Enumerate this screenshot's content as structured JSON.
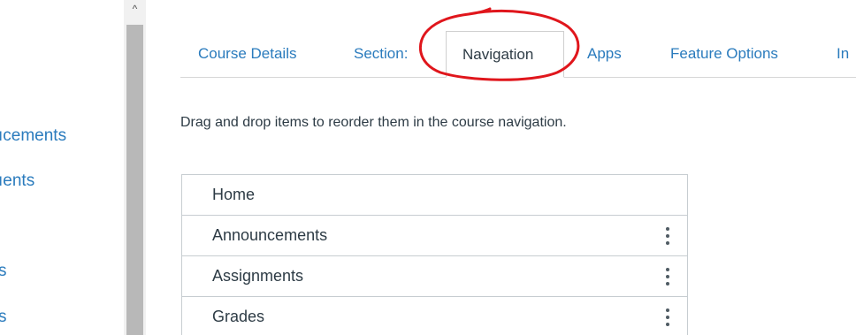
{
  "left_nav": {
    "items": [
      {
        "label": "ıcements"
      },
      {
        "label": "ıents"
      },
      {
        "label": "s"
      },
      {
        "label": "s"
      }
    ]
  },
  "scrollbar": {
    "up_arrow": "^"
  },
  "tabs": [
    {
      "label": "Course Details"
    },
    {
      "label": "Section:"
    },
    {
      "label": "Navigation",
      "active": true
    },
    {
      "label": "Apps"
    },
    {
      "label": "Feature Options"
    },
    {
      "label": "In"
    }
  ],
  "instructions": "Drag and drop items to reorder them in the course navigation.",
  "nav_items": [
    {
      "label": "Home"
    },
    {
      "label": "Announcements",
      "menu_icon": "kebab-menu-icon"
    },
    {
      "label": "Assignments",
      "menu_icon": "kebab-menu-icon"
    },
    {
      "label": "Grades",
      "menu_icon": "kebab-menu-icon"
    }
  ],
  "colors": {
    "link": "#2a7bbd",
    "text": "#2d3b45",
    "highlight": "#e0161c"
  }
}
